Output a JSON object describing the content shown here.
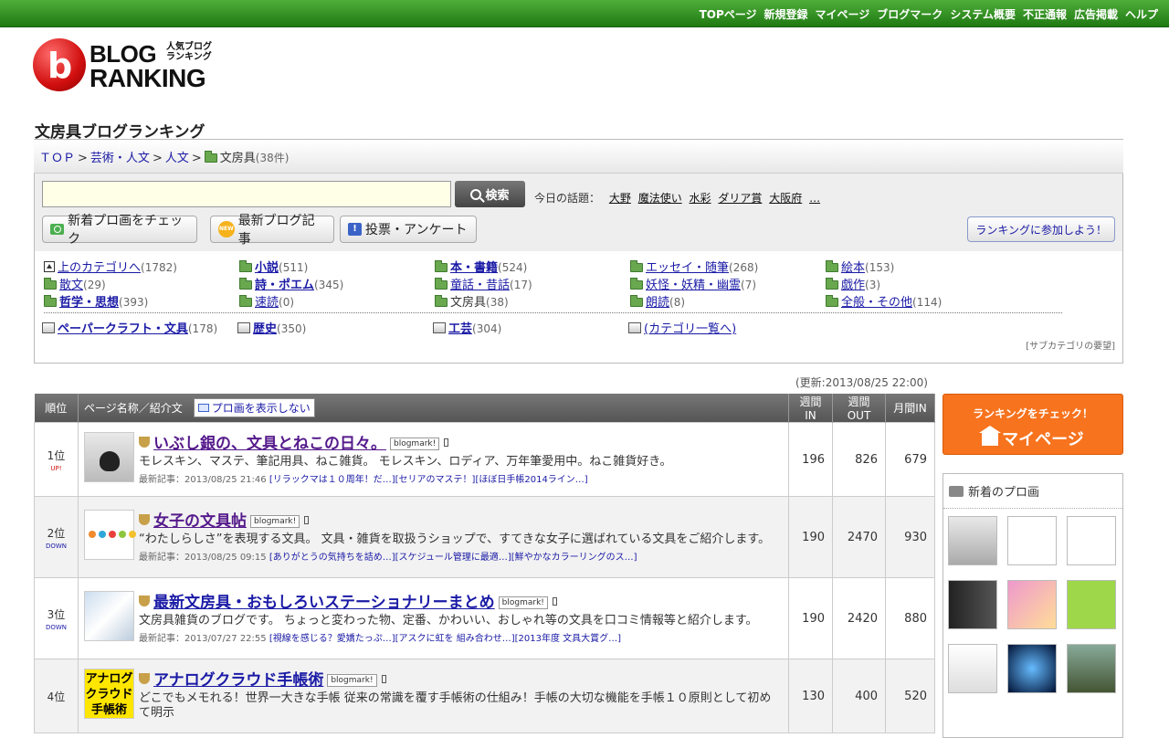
{
  "topnav": [
    "TOPページ",
    "新規登録",
    "マイページ",
    "ブログマーク",
    "システム概要",
    "不正通報",
    "広告掲載",
    "ヘルプ"
  ],
  "logo": {
    "line1": "BLOG",
    "line2": "RANKING",
    "jp": "人気ブログ ランキング"
  },
  "page_title": "文房具ブログランキング",
  "breadcrumb": {
    "top": "ＴＯＰ",
    "c1": "芸術・人文",
    "c2": "人文",
    "current": "文房具",
    "count": "(38件)"
  },
  "search": {
    "placeholder": "",
    "button": "検索"
  },
  "topics": {
    "label": "今日の話題：",
    "items": [
      "大野",
      "魔法使い",
      "水彩",
      "ダリア賞",
      "大阪府",
      "…"
    ]
  },
  "buttons": {
    "new_images": "新着プロ画をチェック",
    "new_posts": "最新ブログ記事",
    "vote": "投票・アンケート",
    "join": "ランキングに参加しよう！",
    "new_badge": "NEW"
  },
  "categories": [
    {
      "name": "上のカテゴリへ",
      "count": "(1782)"
    },
    {
      "name": "小説",
      "count": "(511)"
    },
    {
      "name": "本・書籍",
      "count": "(524)"
    },
    {
      "name": "エッセイ・随筆",
      "count": "(268)"
    },
    {
      "name": "絵本",
      "count": "(153)"
    },
    {
      "name": "散文",
      "count": "(29)"
    },
    {
      "name": "詩・ポエム",
      "count": "(345)"
    },
    {
      "name": "童話・昔話",
      "count": "(17)"
    },
    {
      "name": "妖怪・妖精・幽霊",
      "count": "(7)"
    },
    {
      "name": "戯作",
      "count": "(3)"
    },
    {
      "name": "哲学・思想",
      "count": "(393)"
    },
    {
      "name": "速読",
      "count": "(0)"
    },
    {
      "name": "文房具",
      "count": "(38)"
    },
    {
      "name": "朗読",
      "count": "(8)"
    },
    {
      "name": "全般・その他",
      "count": "(114)"
    },
    {
      "name": "ペーパークラフト・文具",
      "count": "(178)"
    },
    {
      "name": "歴史",
      "count": "(350)"
    },
    {
      "name": "工芸",
      "count": "(304)"
    },
    {
      "name": "(カテゴリ一覧へ)",
      "count": ""
    }
  ],
  "subcat_request": "[サブカテゴリの要望]",
  "updated": "(更新:2013/08/25 22:00)",
  "table_headers": {
    "rank": "順位",
    "page": "ページ名称／紹介文",
    "toggle": "プロ画を表示しない",
    "week_in": "週間IN",
    "week_out": "週間OUT",
    "month_in": "月間IN"
  },
  "latest_label": "最新記事：",
  "blogmark": "blogmark!",
  "entries": [
    {
      "rank": "1位",
      "trend": "UP!",
      "title": "いぶし銀の、文具とねこの日々。",
      "desc": "モレスキン、マステ、筆記用具、ねこ雑貨。 モレスキン、ロディア、万年筆愛用中。ねこ雑貨好き。",
      "date": "2013/08/25 21:46",
      "links": [
        "[リラックマは１０周年！だ…]",
        "[セリアのマステ！]",
        "[ほぼ日手帳2014ライン…]"
      ],
      "week_in": "196",
      "week_out": "826",
      "month_in": "679"
    },
    {
      "rank": "2位",
      "trend": "DOWN",
      "title": "女子の文具帖",
      "desc": "“わたしらしさ”を表現する文具。 文具・雑貨を取扱うショップで、すてきな女子に選ばれている文具をご紹介します。",
      "date": "2013/08/25 09:15",
      "links": [
        "[ありがとうの気持ちを詰め…]",
        "[スケジュール管理に最適…]",
        "[鮮やかなカラーリングのス…]"
      ],
      "week_in": "190",
      "week_out": "2470",
      "month_in": "930"
    },
    {
      "rank": "3位",
      "trend": "DOWN",
      "title": "最新文房具・おもしろいステーショナリーまとめ",
      "desc": "文房具雑貨のブログです。 ちょっと変わった物、定番、かわいい、おしゃれ等の文具を口コミ情報等と紹介します。",
      "date": "2013/07/27 22:55",
      "links": [
        "[視線を感じる？愛嬌たっぷ…]",
        "[アスクに虹を 組み合わせ…]",
        "[2013年度 文具大賞グ…]"
      ],
      "week_in": "190",
      "week_out": "2420",
      "month_in": "880"
    },
    {
      "rank": "4位",
      "trend": "",
      "title": "アナログクラウド手帳術",
      "thumb_text": "アナログ クラウド 手帳術",
      "desc": "どこでもメモれる！世界一大きな手帳 従来の常識を覆す手帳術の仕組み！手帳の大切な機能を手帳１０原則として初めて明示",
      "date": "",
      "links": [],
      "week_in": "130",
      "week_out": "400",
      "month_in": "520"
    }
  ],
  "sidebar": {
    "check_small": "ランキングをチェック！",
    "check_big": "マイページ",
    "new_images": "新着のプロ画"
  }
}
